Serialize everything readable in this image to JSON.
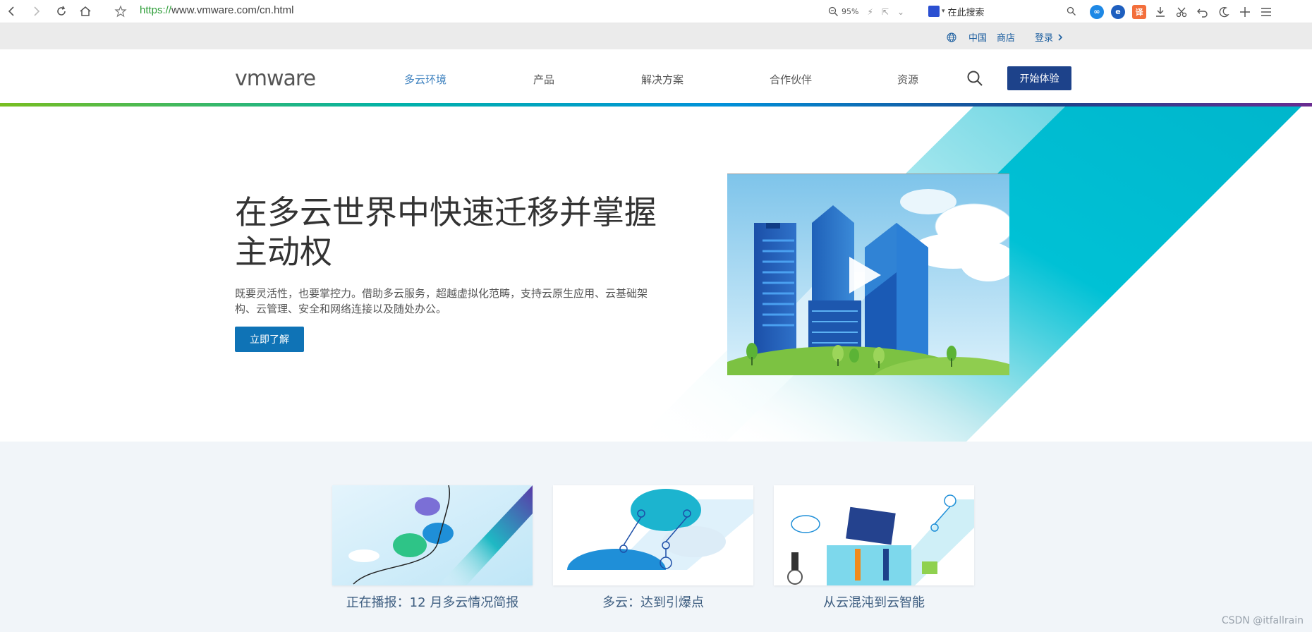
{
  "browser": {
    "url_protocol": "https://",
    "url_rest": "www.vmware.com/cn.html",
    "zoom": "95%",
    "search_placeholder": "在此搜索",
    "translate_label": "译"
  },
  "utility": {
    "region": "中国",
    "store": "商店",
    "login": "登录"
  },
  "nav": {
    "logo": "vmware",
    "items": [
      "多云环境",
      "产品",
      "解决方案",
      "合作伙伴",
      "资源"
    ],
    "cta": "开始体验"
  },
  "hero": {
    "title": "在多云世界中快速迁移并掌握主动权",
    "description": "既要灵活性，也要掌控力。借助多云服务，超越虚拟化范畴，支持云原生应用、云基础架构、云管理、安全和网络连接以及随处办公。",
    "button": "立即了解"
  },
  "cards": [
    {
      "title": "正在播报：12 月多云情况简报"
    },
    {
      "title": "多云：达到引爆点"
    },
    {
      "title": "从云混沌到云智能"
    }
  ],
  "watermark": "CSDN @itfallrain",
  "colors": {
    "brand_blue": "#1d428a",
    "button_blue": "#0f73b6",
    "teal": "#00c1d5",
    "link_blue": "#3a7fbe"
  }
}
